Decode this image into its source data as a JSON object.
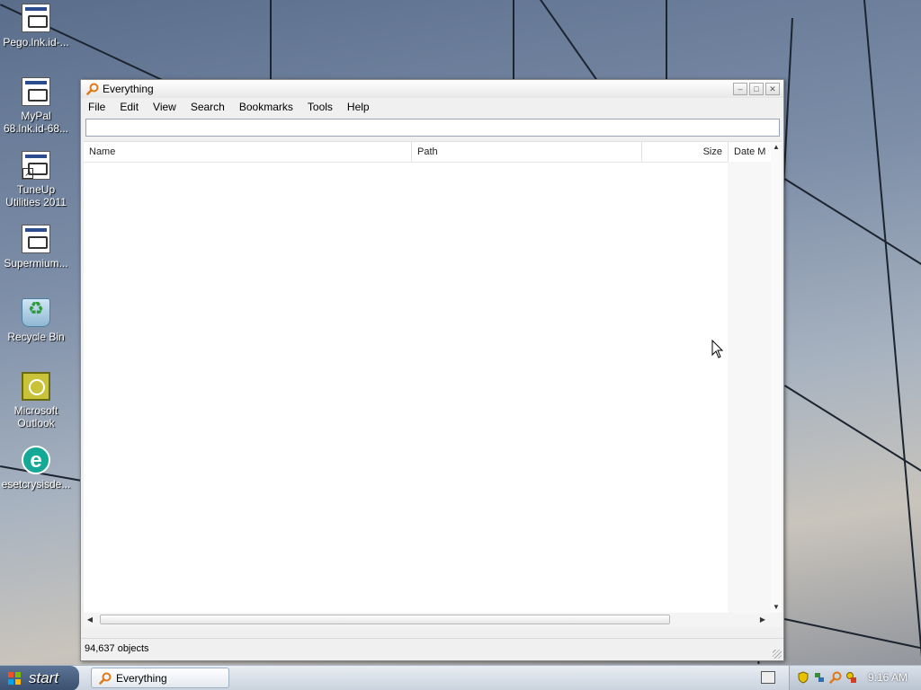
{
  "desktop": {
    "icons": [
      {
        "label": "Pego.lnk.id-..."
      },
      {
        "label": "MyPal 68.lnk.id-68..."
      },
      {
        "label": "TuneUp Utilities 2011"
      },
      {
        "label": "Supermium..."
      },
      {
        "label": "Recycle Bin"
      },
      {
        "label": "Microsoft Outlook"
      },
      {
        "label": "esetcrysisde..."
      }
    ]
  },
  "window": {
    "title": "Everything",
    "icon": "magnifier-icon",
    "menu": [
      "File",
      "Edit",
      "View",
      "Search",
      "Bookmarks",
      "Tools",
      "Help"
    ],
    "search": {
      "value": "",
      "placeholder": ""
    },
    "columns": [
      "Name",
      "Path",
      "Size",
      "Date M"
    ],
    "rows": [],
    "status": "94,637 objects"
  },
  "taskbar": {
    "start_label": "start",
    "tasks": [
      {
        "label": "Everything",
        "icon": "magnifier-icon"
      }
    ],
    "clock": "9:16 AM",
    "tray_icons": [
      "keyboard-icon",
      "shield-icon",
      "network-icon",
      "magnifier-icon",
      "security-icon"
    ]
  },
  "colors": {
    "accent": "#e07818",
    "taskbar": "#c9d2dd",
    "start": "#3b4f6e"
  }
}
